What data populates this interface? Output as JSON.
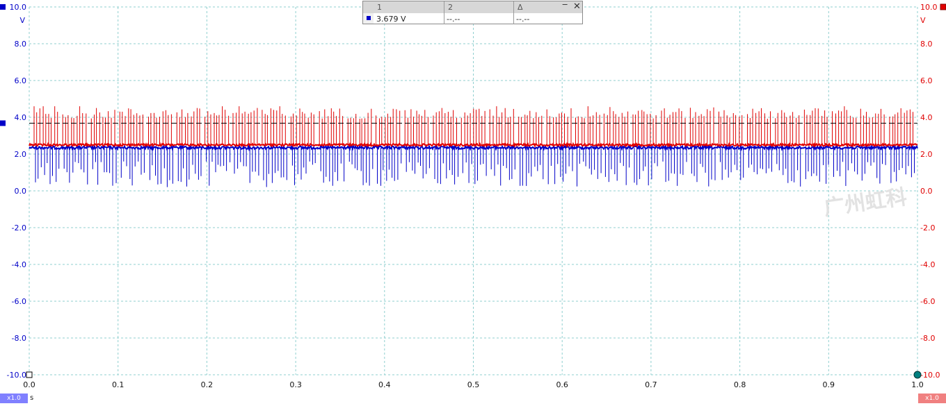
{
  "chart_data": {
    "type": "line",
    "x": {
      "ticks": [
        "0.0",
        "0.1",
        "0.2",
        "0.3",
        "0.4",
        "0.5",
        "0.6",
        "0.7",
        "0.8",
        "0.9",
        "1.0"
      ],
      "range": [
        0,
        1
      ],
      "unit": "s"
    },
    "y_left": {
      "ticks": [
        "10.0",
        "8.0",
        "6.0",
        "4.0",
        "2.0",
        "0.0",
        "-2.0",
        "-4.0",
        "-6.0",
        "-8.0",
        "-10.0"
      ],
      "range": [
        -10,
        10
      ],
      "unit": "V",
      "color": "#0000c8"
    },
    "y_right": {
      "ticks": [
        "10.0",
        "8.0",
        "6.0",
        "4.0",
        "2.0",
        "0.0",
        "-2.0",
        "-4.0",
        "-6.0",
        "-8.0",
        "-10.0"
      ],
      "range": [
        -10,
        10
      ],
      "unit": "V",
      "color": "#e00000"
    },
    "grid": true,
    "series": [
      {
        "channel": 2,
        "color": "#e00000",
        "baseline": 2.5,
        "spike_max": 4.6,
        "spike_typical": 4.1,
        "spike_count": 280
      },
      {
        "channel": 1,
        "color": "#0000c8",
        "baseline": 2.35,
        "spike_min": 0.1,
        "spike_typical": 0.9,
        "spike_count": 280
      }
    ],
    "cursor_level": 3.679,
    "cursor_color": "#000000"
  },
  "readout": {
    "col1": "1",
    "col2": "2",
    "col3": "Δ",
    "val1": "3.679 V",
    "val2": "--.--",
    "val3": "--.--"
  },
  "scale_left": "x1.0",
  "scale_right": "x1.0",
  "time_unit": "s",
  "watermark": "广州虹科",
  "colors": {
    "grid": "#8fcfcf",
    "axis_left": "#0000c8",
    "axis_right": "#e00000",
    "scale_left_bg": "#8080ff",
    "scale_right_bg": "#f08080",
    "trigger_marker": "#008080"
  }
}
